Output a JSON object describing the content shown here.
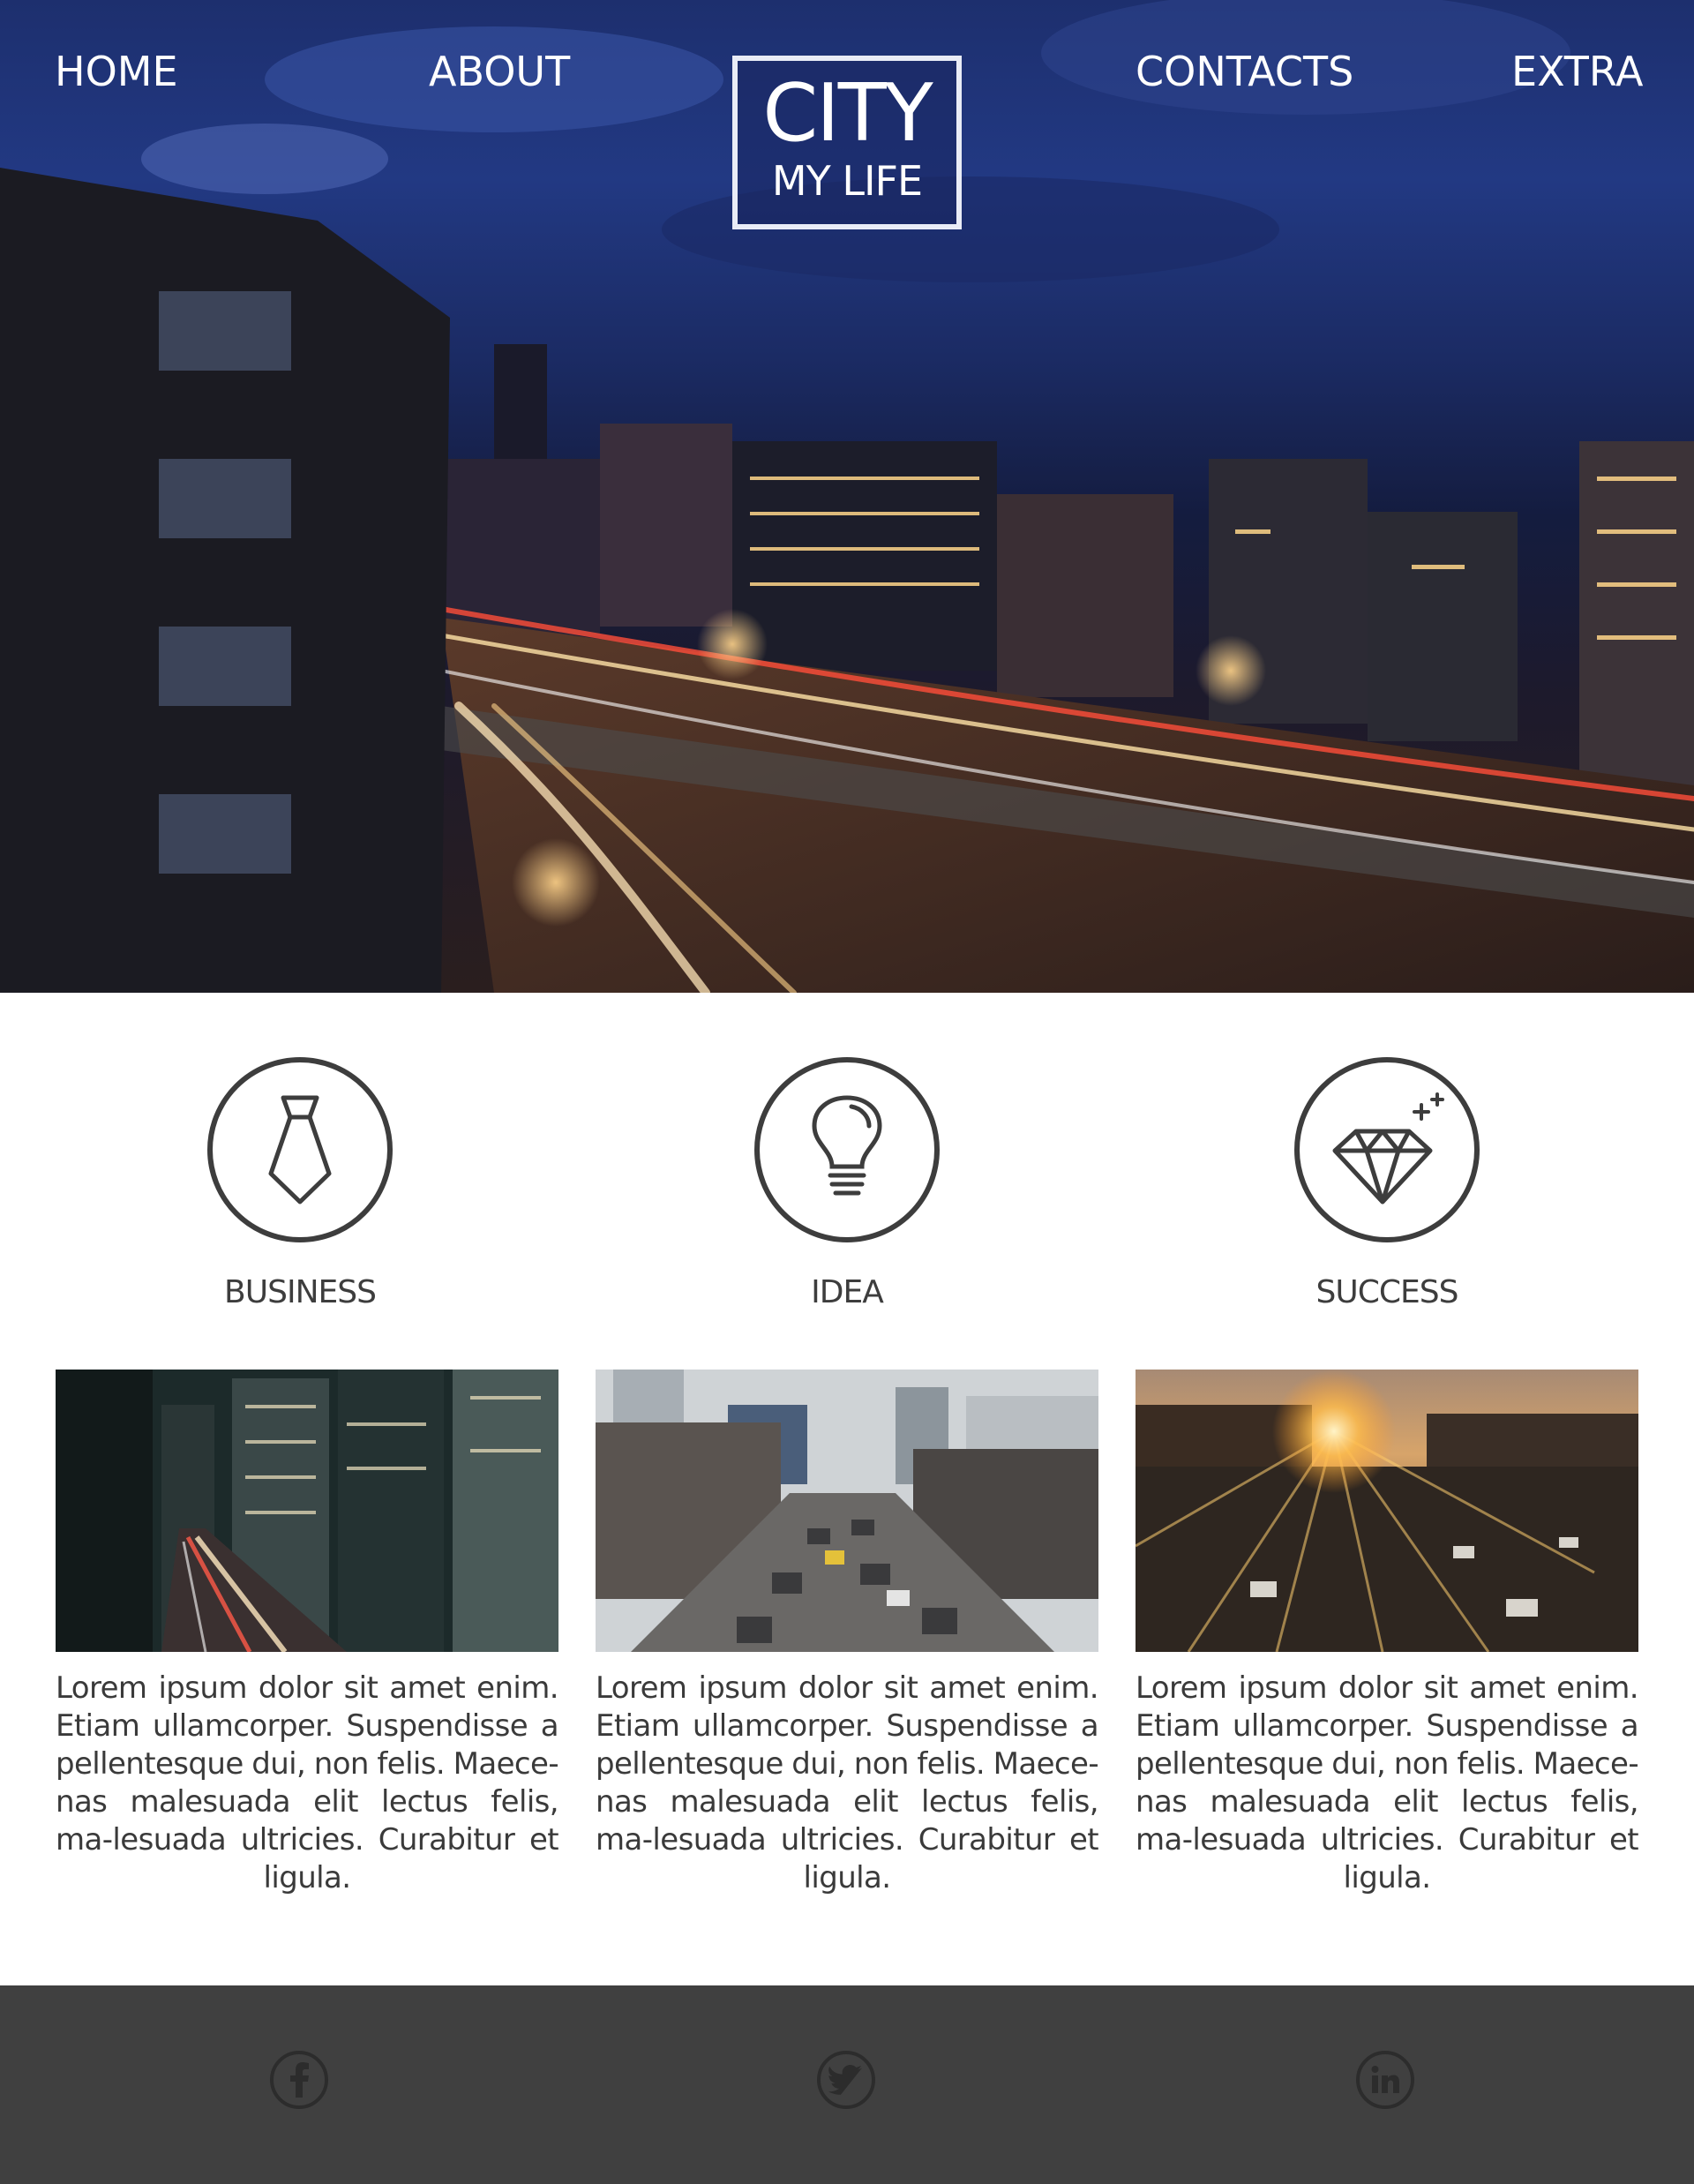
{
  "nav": {
    "home": "HOME",
    "about": "ABOUT",
    "contacts": "CONTACTS",
    "extra": "EXTRA"
  },
  "logo": {
    "line1": "CITY",
    "line2": "MY LIFE"
  },
  "features": [
    {
      "label": "BUSINESS",
      "icon": "tie-icon"
    },
    {
      "label": "IDEA",
      "icon": "lightbulb-icon"
    },
    {
      "label": "SUCCESS",
      "icon": "diamond-icon"
    }
  ],
  "cards": [
    {
      "text": "Lorem ipsum dolor sit amet enim. Etiam ullamcorper. Suspendisse a pellentesque dui, non felis. Maece-nas malesuada elit lectus felis, ma-lesuada ultricies. Curabitur et ligula."
    },
    {
      "text": "Lorem ipsum dolor sit amet enim. Etiam ullamcorper. Suspendisse a pellentesque dui, non felis. Maece-nas malesuada elit lectus felis, ma-lesuada ultricies. Curabitur et ligula."
    },
    {
      "text": "Lorem ipsum dolor sit amet enim. Etiam ullamcorper. Suspendisse a pellentesque dui, non felis. Maece-nas malesuada elit lectus felis, ma-lesuada ultricies. Curabitur et ligula."
    }
  ],
  "footer": {
    "social": [
      "facebook-icon",
      "twitter-icon",
      "linkedin-icon"
    ]
  },
  "colors": {
    "text": "#3a3a3a",
    "icon_stroke": "#3d3d3d",
    "footer_bg": "#404040",
    "footer_icon": "#2c2c2c",
    "hero_sky": "#223983",
    "nav_text": "#ffffff"
  }
}
